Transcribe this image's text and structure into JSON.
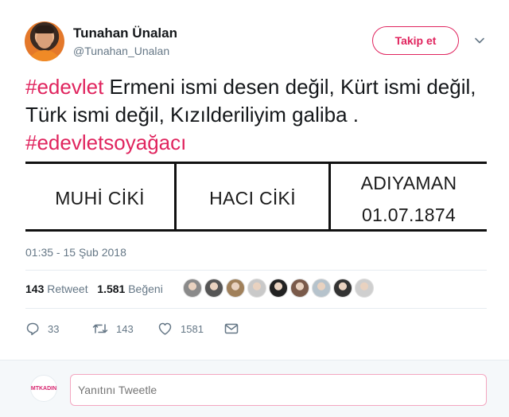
{
  "header": {
    "display_name": "Tunahan Ünalan",
    "handle": "@Tunahan_Unalan",
    "follow_label": "Takip et"
  },
  "tweet": {
    "hashtag1": "#edevlet",
    "body": " Ermeni ismi desen değil, Kürt ismi değil, Türk ismi değil, Kızılderiliyim galiba .",
    "hashtag2": "#edevletsoyağacı"
  },
  "media": {
    "cells": [
      "MUHİ CİKİ",
      "HACI CİKİ",
      "ADIYAMAN",
      "01.07.1874"
    ]
  },
  "timestamp": "01:35 - 15 Şub 2018",
  "stats": {
    "retweet_count": "143",
    "retweet_label": "Retweet",
    "like_count": "1.581",
    "like_label": "Beğeni"
  },
  "likers": [
    "#8a8a8a",
    "#555555",
    "#a0805a",
    "#c9c9c9",
    "#222222",
    "#7a5a4a",
    "#b6c3cc",
    "#333333",
    "#cfcfcf"
  ],
  "actions": {
    "reply_count": "33",
    "retweet_count": "143",
    "like_count": "1581"
  },
  "reply": {
    "avatar_text": "MTKADIN",
    "placeholder": "Yanıtını Tweetle"
  },
  "colors": {
    "accent": "#e0245e",
    "secondary_text": "#657786"
  }
}
